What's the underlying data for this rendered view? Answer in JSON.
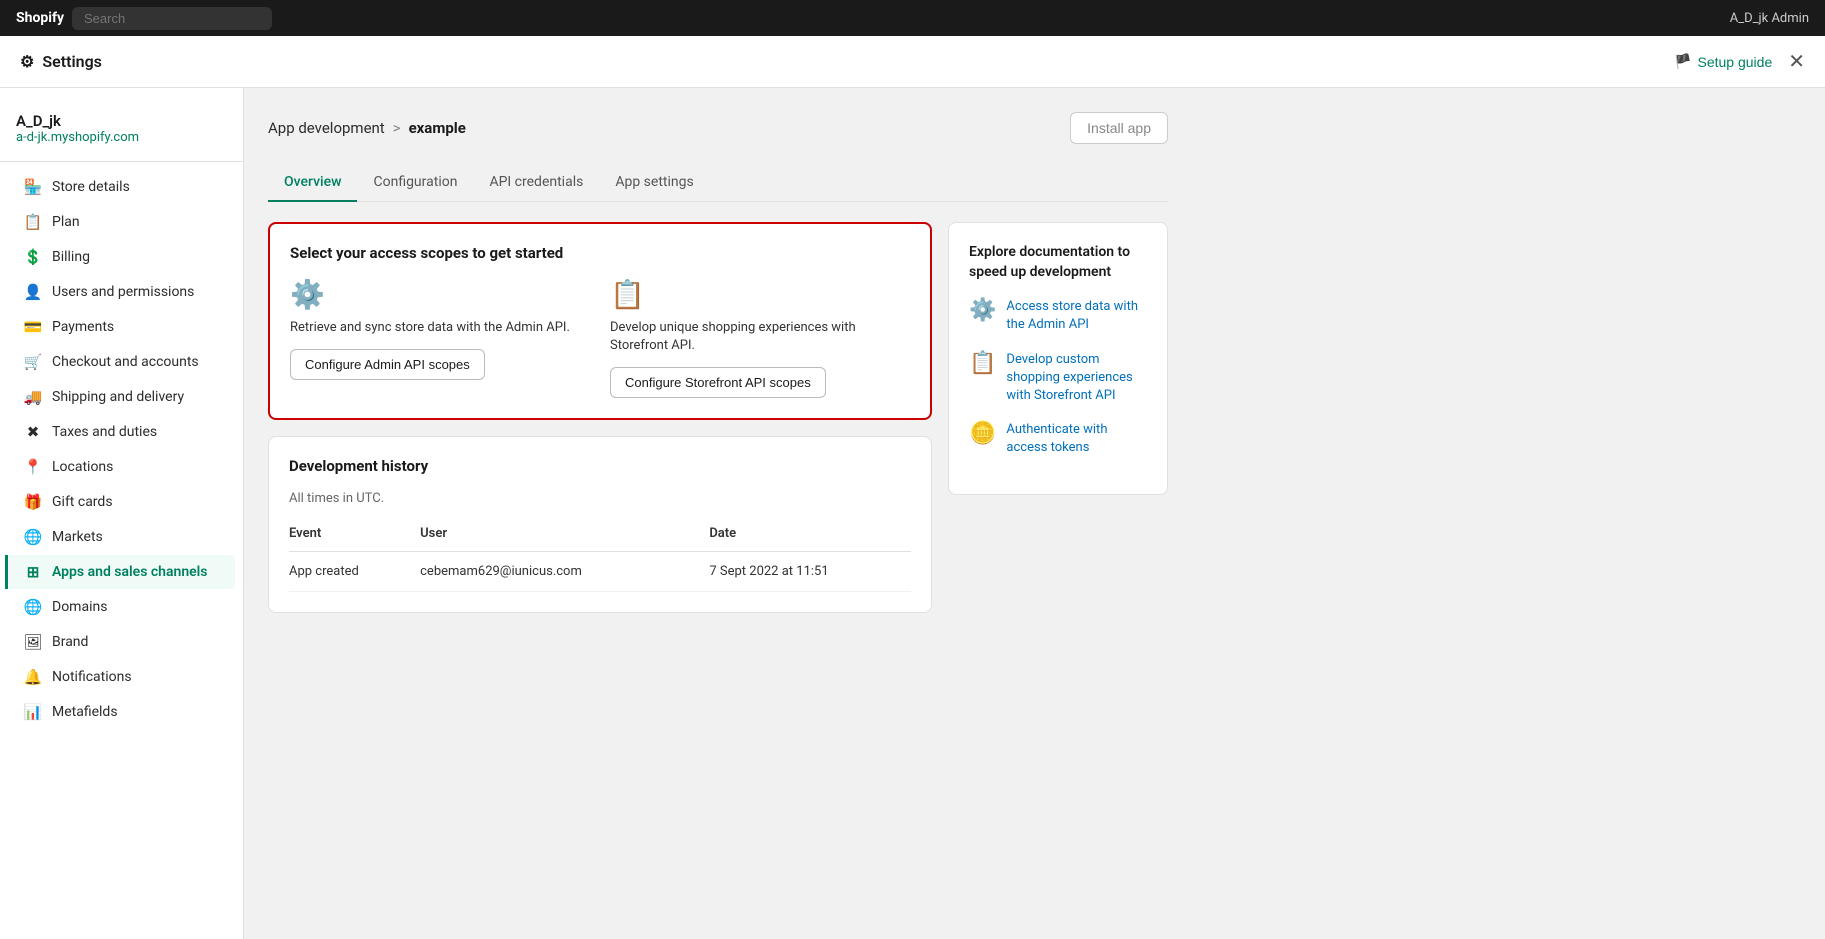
{
  "topbar": {
    "logo": "Shopify",
    "search_placeholder": "Search",
    "user_label": "A_D_jk Admin"
  },
  "settings_bar": {
    "title": "Settings",
    "settings_icon": "⚙",
    "setup_guide_label": "Setup guide",
    "close_label": "✕"
  },
  "sidebar": {
    "store_name": "A_D_jk",
    "store_url": "a-d-jk.myshopify.com",
    "nav_items": [
      {
        "id": "store-details",
        "label": "Store details",
        "icon": "🏪"
      },
      {
        "id": "plan",
        "label": "Plan",
        "icon": "📋"
      },
      {
        "id": "billing",
        "label": "Billing",
        "icon": "💲"
      },
      {
        "id": "users-permissions",
        "label": "Users and permissions",
        "icon": "👤"
      },
      {
        "id": "payments",
        "label": "Payments",
        "icon": "💳"
      },
      {
        "id": "checkout-accounts",
        "label": "Checkout and accounts",
        "icon": "🛒"
      },
      {
        "id": "shipping-delivery",
        "label": "Shipping and delivery",
        "icon": "🚚"
      },
      {
        "id": "taxes-duties",
        "label": "Taxes and duties",
        "icon": "✖"
      },
      {
        "id": "locations",
        "label": "Locations",
        "icon": "📍"
      },
      {
        "id": "gift-cards",
        "label": "Gift cards",
        "icon": "🎁"
      },
      {
        "id": "markets",
        "label": "Markets",
        "icon": "🌐"
      },
      {
        "id": "apps-sales-channels",
        "label": "Apps and sales channels",
        "icon": "⊞",
        "active": true
      },
      {
        "id": "domains",
        "label": "Domains",
        "icon": "🌐"
      },
      {
        "id": "brand",
        "label": "Brand",
        "icon": "🖼"
      },
      {
        "id": "notifications",
        "label": "Notifications",
        "icon": "🔔"
      },
      {
        "id": "metafields",
        "label": "Metafields",
        "icon": "📊"
      }
    ]
  },
  "page": {
    "breadcrumb_parent": "App development",
    "breadcrumb_separator": ">",
    "breadcrumb_current": "example",
    "install_app_label": "Install app",
    "tabs": [
      {
        "id": "overview",
        "label": "Overview",
        "active": true
      },
      {
        "id": "configuration",
        "label": "Configuration"
      },
      {
        "id": "api-credentials",
        "label": "API credentials"
      },
      {
        "id": "app-settings",
        "label": "App settings"
      }
    ],
    "access_scopes": {
      "title": "Select your access scopes to get started",
      "admin_api": {
        "icon": "⚙️",
        "description": "Retrieve and sync store data with the Admin API.",
        "button_label": "Configure Admin API scopes"
      },
      "storefront_api": {
        "icon": "📋",
        "description": "Develop unique shopping experiences with Storefront API.",
        "button_label": "Configure Storefront API scopes"
      }
    },
    "dev_history": {
      "title": "Development history",
      "subtitle": "All times in UTC.",
      "columns": [
        "Event",
        "User",
        "Date"
      ],
      "rows": [
        {
          "event": "App created",
          "user": "cebemam629@iunicus.com",
          "date": "7 Sept 2022 at 11:51"
        }
      ]
    },
    "doc_card": {
      "title": "Explore documentation to speed up development",
      "links": [
        {
          "icon": "⚙️",
          "label": "Access store data with the Admin API"
        },
        {
          "icon": "📋",
          "label": "Develop custom shopping experiences with Storefront API"
        },
        {
          "icon": "🪙",
          "label": "Authenticate with access tokens"
        }
      ]
    }
  }
}
